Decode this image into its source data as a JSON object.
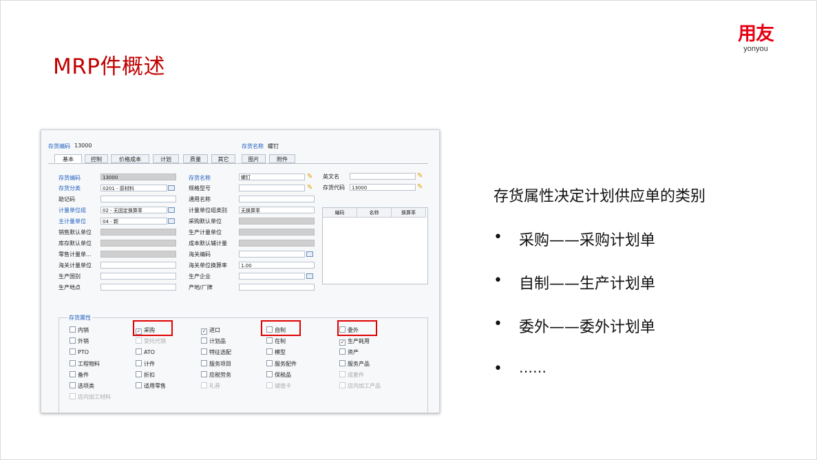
{
  "slide": {
    "title": "MRP件概述",
    "logo": {
      "cn": "用友",
      "en": "yonyou"
    }
  },
  "screenshot": {
    "header": {
      "code_label": "存货编码",
      "code_value": "13000",
      "name_label": "存货名称",
      "name_value": "螺钉"
    },
    "tabs": [
      "基本",
      "控制",
      "价格成本",
      "计划",
      "质量",
      "其它",
      "图片",
      "附件"
    ],
    "col1": [
      {
        "label": "存货编码",
        "value": "13000"
      },
      {
        "label": "存货分类",
        "value": "0201 - 原材料"
      },
      {
        "label": "助记码",
        "value": ""
      },
      {
        "label": "计量单位组",
        "value": "02 - 无固定换算率"
      },
      {
        "label": "主计量单位",
        "value": "04 - 颗"
      },
      {
        "label": "销售默认单位",
        "value": ""
      },
      {
        "label": "库存默认单位",
        "value": ""
      },
      {
        "label": "零售计量单...",
        "value": ""
      },
      {
        "label": "海关计量单位",
        "value": ""
      },
      {
        "label": "生产国别",
        "value": ""
      },
      {
        "label": "生产地点",
        "value": ""
      }
    ],
    "col2": [
      {
        "label": "存货名称",
        "value": "螺钉"
      },
      {
        "label": "规格型号",
        "value": ""
      },
      {
        "label": "通用名称",
        "value": ""
      },
      {
        "label": "计量单位组类别",
        "value": "无换算率"
      },
      {
        "label": "采购默认单位",
        "value": ""
      },
      {
        "label": "生产计量单位",
        "value": ""
      },
      {
        "label": "成本默认辅计量",
        "value": ""
      },
      {
        "label": "海关编码",
        "value": ""
      },
      {
        "label": "海关单位换算率",
        "value": "1.00"
      },
      {
        "label": "生产企业",
        "value": ""
      },
      {
        "label": "产地/厂牌",
        "value": ""
      }
    ],
    "col3": [
      {
        "label": "英文名",
        "value": ""
      },
      {
        "label": "存货代码",
        "value": "13000"
      }
    ],
    "grid_headers": [
      "编码",
      "名称",
      "换算率"
    ],
    "group_title": "存货属性",
    "checkboxes": [
      [
        {
          "label": "内销",
          "checked": false,
          "disabled": false
        },
        {
          "label": "采购",
          "checked": true,
          "disabled": false
        },
        {
          "label": "进口",
          "checked": true,
          "disabled": false
        },
        {
          "label": "自制",
          "checked": false,
          "disabled": false
        },
        {
          "label": "委外",
          "checked": false,
          "disabled": false
        }
      ],
      [
        {
          "label": "外销",
          "checked": false,
          "disabled": false
        },
        {
          "label": "受托代销",
          "checked": false,
          "disabled": true
        },
        {
          "label": "计划品",
          "checked": false,
          "disabled": false
        },
        {
          "label": "在制",
          "checked": false,
          "disabled": false
        },
        {
          "label": "生产耗用",
          "checked": true,
          "disabled": false
        }
      ],
      [
        {
          "label": "PTO",
          "checked": false,
          "disabled": false
        },
        {
          "label": "ATO",
          "checked": false,
          "disabled": false
        },
        {
          "label": "特征选配",
          "checked": false,
          "disabled": false
        },
        {
          "label": "模型",
          "checked": false,
          "disabled": false
        },
        {
          "label": "资产",
          "checked": false,
          "disabled": false
        }
      ],
      [
        {
          "label": "工程物料",
          "checked": false,
          "disabled": false
        },
        {
          "label": "计件",
          "checked": false,
          "disabled": false
        },
        {
          "label": "服务项目",
          "checked": false,
          "disabled": false
        },
        {
          "label": "服务配件",
          "checked": false,
          "disabled": false
        },
        {
          "label": "服务产品",
          "checked": false,
          "disabled": false
        }
      ],
      [
        {
          "label": "备件",
          "checked": false,
          "disabled": false
        },
        {
          "label": "折扣",
          "checked": false,
          "disabled": false
        },
        {
          "label": "应税劳务",
          "checked": false,
          "disabled": false
        },
        {
          "label": "保税品",
          "checked": false,
          "disabled": false
        },
        {
          "label": "成套件",
          "checked": false,
          "disabled": true
        }
      ],
      [
        {
          "label": "选项类",
          "checked": false,
          "disabled": false
        },
        {
          "label": "适用零售",
          "checked": false,
          "disabled": false
        },
        {
          "label": "礼券",
          "checked": false,
          "disabled": true
        },
        {
          "label": "储值卡",
          "checked": false,
          "disabled": true
        },
        {
          "label": "店内加工产品",
          "checked": false,
          "disabled": true
        }
      ],
      [
        {
          "label": "店内加工材料",
          "checked": false,
          "disabled": true
        }
      ]
    ]
  },
  "right": {
    "heading": "存货属性决定计划供应单的类别",
    "bullets": [
      "采购——采购计划单",
      "自制——生产计划单",
      "委外——委外计划单",
      "……"
    ],
    "bullet_char": "•"
  }
}
